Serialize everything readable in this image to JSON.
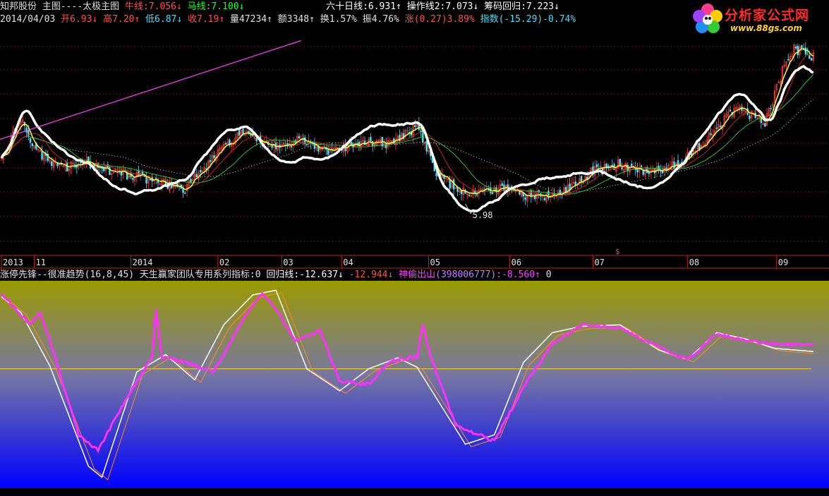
{
  "header": {
    "stock_name": "知邦股份",
    "main_chart_label": "主图----太极主图",
    "bull_line_label": "牛线:7.056",
    "bull_arrow": "↓",
    "horse_line_label": "马线:7.100",
    "horse_arrow": "↓",
    "sixty_day_label": "六十日线:6.931",
    "sixty_day_arrow": "↑",
    "operate_line_label": "操作线2:7.073",
    "operate_arrow": "↓",
    "chip_label": "筹码回归:7.223",
    "chip_arrow": "↓"
  },
  "quote": {
    "date": "2014/04/03",
    "open": "开6.93",
    "open_arrow": "↓",
    "high": "高7.20",
    "high_arrow": "↑",
    "low": "低6.87",
    "low_arrow": "↓",
    "close": "收7.19",
    "close_arrow": "↑",
    "volume": "量47234",
    "volume_arrow": "↑",
    "amount": "额3348",
    "amount_arrow": "↑",
    "turnover": "换1.57%",
    "amplitude": "振4.76%",
    "change": "涨(0.27)3.89%",
    "index": "指数(-15.29)-0.74%"
  },
  "indicator": {
    "title": "涨停先锋--很准趋势(16,8,45)",
    "team_label": "天生赢家团队专用系列指标:0",
    "regress_label": "回归线:-12.637",
    "regress_arrow": "↓",
    "second_value": "-12.944",
    "second_arrow": "↓",
    "shentou_label": "神偷出山",
    "shentou_id": "(398006777)",
    "shentou_value": ":-8.560",
    "shentou_arrow": "↑",
    "last_value": "0"
  },
  "logo": {
    "name": "分析家公式网",
    "url": "www.88gs.com"
  },
  "colors": {
    "up": "#ff3c3c",
    "down": "#4fe3ff",
    "ma_short": "#ffff33",
    "ma_mid": "#cc2020",
    "ma_long": "#30c030",
    "taiji": "#ffffff",
    "trend": "#ff40ff",
    "indicator_fast": "#ffffff",
    "indicator_slow": "#ff8c1a",
    "indicator_line": "#ff30ff",
    "zero_line": "#ffd700"
  },
  "chart_data": [
    {
      "type": "candlestick",
      "x_axis_ticks": [
        "2013",
        "11",
        "2014",
        "02",
        "03",
        "04",
        "05",
        "06",
        "07",
        "08",
        "09"
      ],
      "x_tick_index": [
        0,
        17,
        67,
        112,
        145,
        176,
        221,
        263,
        306,
        355,
        401
      ],
      "ylim": [
        5.5,
        8.2
      ],
      "grid": true,
      "min_annotation": {
        "label": "5.98",
        "value": 5.98,
        "index": 240
      },
      "series_lines": [
        "牛线",
        "马线",
        "六十日线",
        "操作线2",
        "筹码回归"
      ],
      "price_points": [
        [
          0,
          6.6
        ],
        [
          10,
          7.1
        ],
        [
          18,
          6.7
        ],
        [
          30,
          6.5
        ],
        [
          45,
          6.55
        ],
        [
          60,
          6.45
        ],
        [
          80,
          6.35
        ],
        [
          95,
          6.25
        ],
        [
          110,
          6.65
        ],
        [
          125,
          6.95
        ],
        [
          140,
          6.75
        ],
        [
          155,
          6.85
        ],
        [
          170,
          6.7
        ],
        [
          185,
          6.8
        ],
        [
          200,
          6.8
        ],
        [
          215,
          7.0
        ],
        [
          225,
          6.45
        ],
        [
          235,
          6.25
        ],
        [
          245,
          6.2
        ],
        [
          260,
          6.25
        ],
        [
          275,
          6.15
        ],
        [
          290,
          6.2
        ],
        [
          305,
          6.45
        ],
        [
          320,
          6.55
        ],
        [
          335,
          6.45
        ],
        [
          350,
          6.55
        ],
        [
          365,
          6.85
        ],
        [
          380,
          7.25
        ],
        [
          395,
          7.05
        ],
        [
          405,
          7.75
        ],
        [
          410,
          7.95
        ],
        [
          420,
          7.85
        ]
      ],
      "indicator_points": [
        [
          0,
          -14.1
        ],
        [
          10,
          -14.6
        ],
        [
          25,
          -16.3
        ],
        [
          45,
          -19.5
        ],
        [
          52,
          -19.85
        ],
        [
          70,
          -16.5
        ],
        [
          85,
          -15.95
        ],
        [
          100,
          -16.75
        ],
        [
          115,
          -15.0
        ],
        [
          130,
          -14.05
        ],
        [
          142,
          -13.9
        ],
        [
          158,
          -16.4
        ],
        [
          175,
          -17.1
        ],
        [
          190,
          -16.4
        ],
        [
          205,
          -16.05
        ],
        [
          215,
          -16.35
        ],
        [
          240,
          -18.8
        ],
        [
          255,
          -18.5
        ],
        [
          270,
          -16.2
        ],
        [
          285,
          -15.25
        ],
        [
          300,
          -15.05
        ],
        [
          320,
          -15.0
        ],
        [
          340,
          -15.8
        ],
        [
          355,
          -16.1
        ],
        [
          370,
          -15.25
        ],
        [
          385,
          -15.45
        ],
        [
          400,
          -15.75
        ],
        [
          420,
          -15.85
        ]
      ],
      "trend_points": [
        [
          0,
          -14.0
        ],
        [
          15,
          -15.0
        ],
        [
          20,
          -14.6
        ],
        [
          25,
          -15.5
        ],
        [
          40,
          -18.5
        ],
        [
          50,
          -19.0
        ],
        [
          65,
          -17.3
        ],
        [
          78,
          -16.0
        ],
        [
          80,
          -14.5
        ],
        [
          83,
          -16.0
        ],
        [
          95,
          -16.2
        ],
        [
          110,
          -16.5
        ],
        [
          125,
          -14.8
        ],
        [
          135,
          -14.0
        ],
        [
          142,
          -14.5
        ],
        [
          152,
          -15.5
        ],
        [
          165,
          -15.2
        ],
        [
          175,
          -16.8
        ],
        [
          190,
          -16.9
        ],
        [
          200,
          -16.2
        ],
        [
          215,
          -16.0
        ],
        [
          218,
          -15.0
        ],
        [
          222,
          -16.0
        ],
        [
          235,
          -18.2
        ],
        [
          255,
          -18.7
        ],
        [
          270,
          -17.0
        ],
        [
          285,
          -15.6
        ],
        [
          300,
          -15.0
        ],
        [
          320,
          -15.1
        ],
        [
          340,
          -15.7
        ],
        [
          355,
          -16.1
        ],
        [
          370,
          -15.3
        ],
        [
          385,
          -15.5
        ],
        [
          400,
          -15.6
        ],
        [
          412,
          -15.65
        ],
        [
          420,
          -15.6
        ]
      ],
      "indicator_ylim": [
        -20.2,
        -13.6
      ],
      "indicator_zero": -16.4
    }
  ]
}
